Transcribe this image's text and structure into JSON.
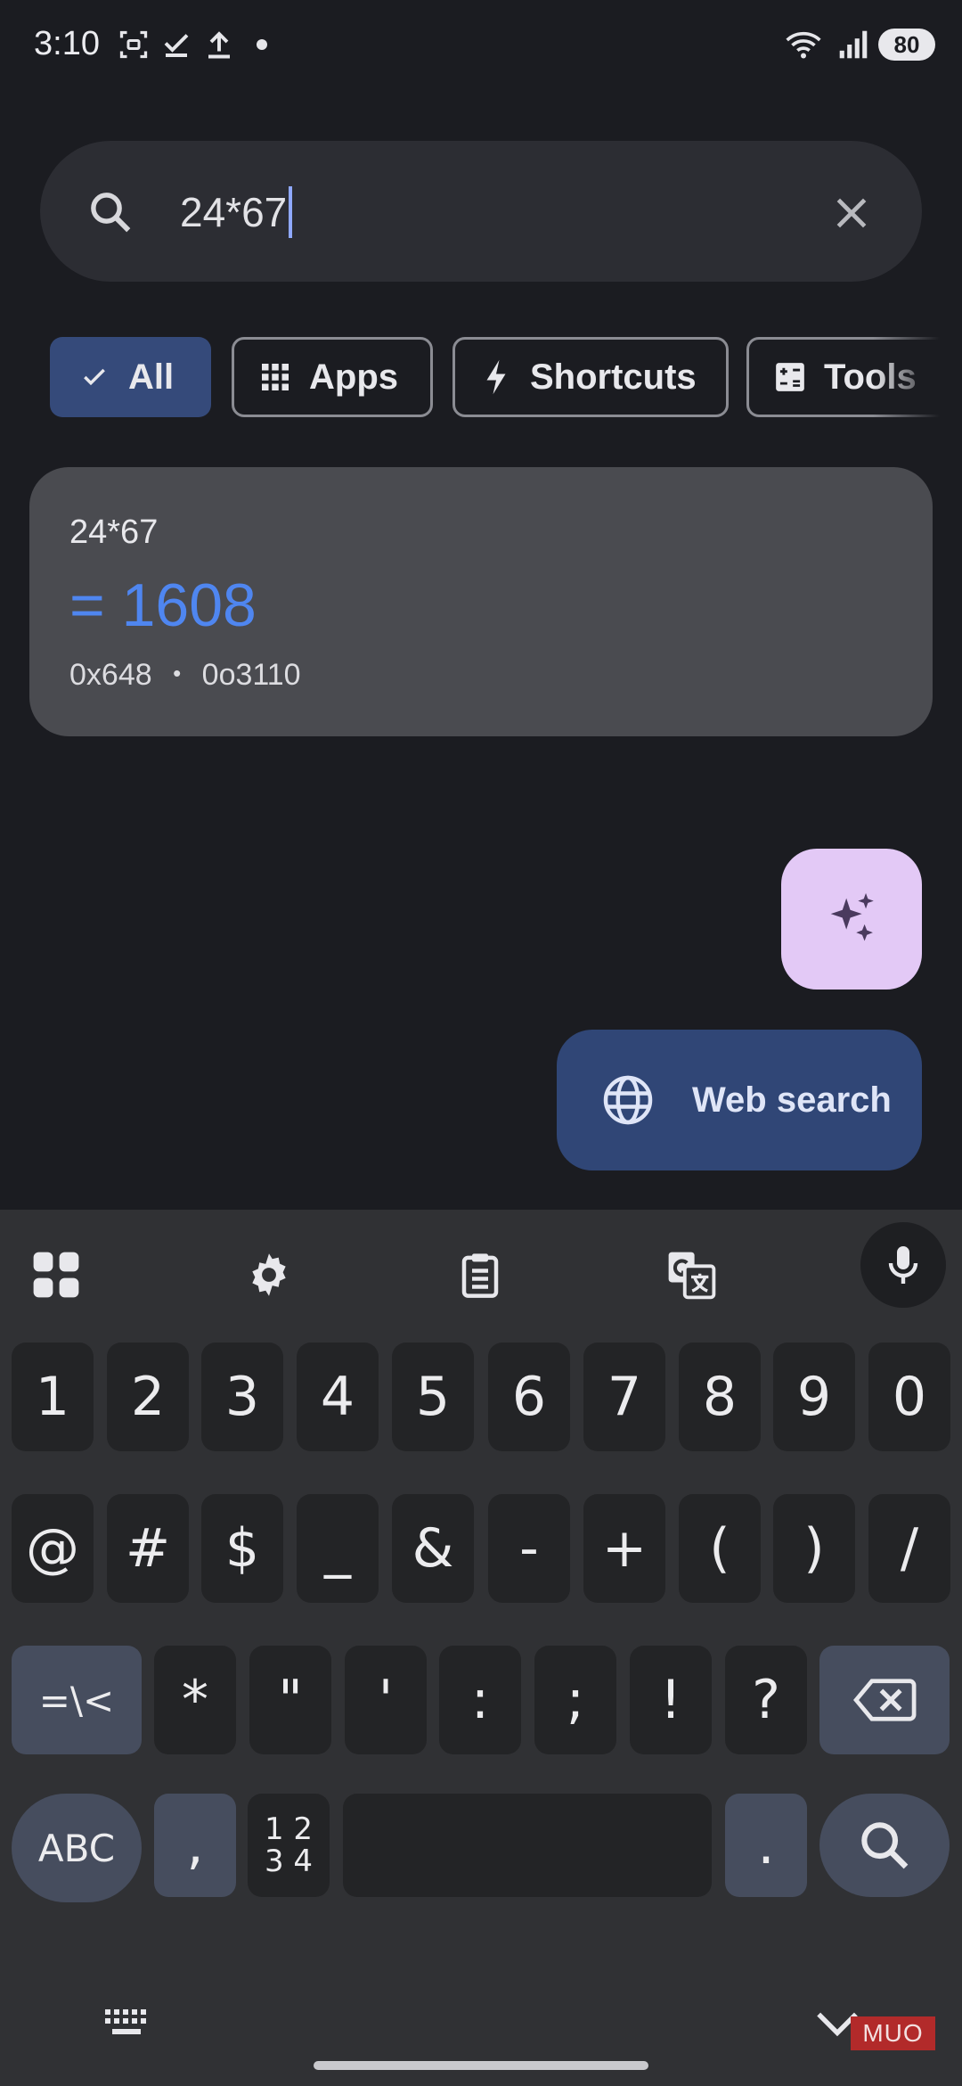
{
  "status_bar": {
    "time": "3:10",
    "battery": "80",
    "icons": [
      "screenshot-icon",
      "check-icon",
      "upload-icon",
      "dot-icon",
      "wifi-icon",
      "signal-icon"
    ]
  },
  "search": {
    "query": "24*67",
    "search_icon": "search-icon",
    "clear_icon": "close-icon"
  },
  "filters": {
    "selected": "All",
    "chips": [
      {
        "label": "All",
        "icon": "check-icon"
      },
      {
        "label": "Apps",
        "icon": "apps-grid-icon"
      },
      {
        "label": "Shortcuts",
        "icon": "bolt-icon"
      },
      {
        "label": "Tools",
        "icon": "calculator-icon"
      }
    ]
  },
  "calculator": {
    "expression": "24*67",
    "result": "= 1608",
    "hex": "0x648",
    "separator": "•",
    "octal": "0o3110"
  },
  "ai_fab_icon": "sparkle-icon",
  "web_search": {
    "label": "Web search",
    "icon": "globe-icon"
  },
  "keyboard": {
    "toolbar_icons": [
      "apps-grid-icon",
      "gear-icon",
      "clipboard-icon",
      "translate-icon",
      "mic-icon"
    ],
    "row1": [
      "1",
      "2",
      "3",
      "4",
      "5",
      "6",
      "7",
      "8",
      "9",
      "0"
    ],
    "row2": [
      "@",
      "#",
      "$",
      "_",
      "&",
      "-",
      "+",
      "(",
      ")",
      "/"
    ],
    "row3": [
      "=\\<",
      "*",
      "\"",
      "'",
      ":",
      ";",
      "!",
      "?"
    ],
    "row4": {
      "abc": "ABC",
      "comma": ",",
      "numpad_top": "1 2",
      "numpad_bottom": "3 4",
      "period": "."
    },
    "bottom_icons": [
      "keyboard-icon",
      "chevron-down-icon"
    ]
  },
  "watermark": "MUO",
  "colors": {
    "background": "#1b1c21",
    "accent_blue": "#4f86f0",
    "chip_selected": "#354a7a",
    "web_search_bg": "#304676",
    "ai_fab_bg": "#e3c9f6"
  }
}
